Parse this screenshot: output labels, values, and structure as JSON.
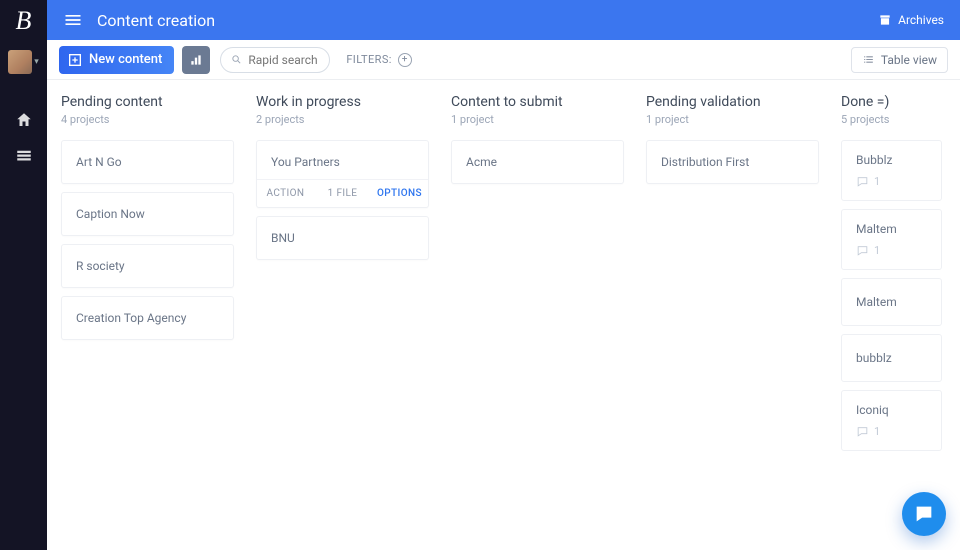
{
  "header": {
    "title": "Content creation",
    "archives": "Archives"
  },
  "toolbar": {
    "new_label": "New content",
    "search_placeholder": "Rapid search",
    "filters_label": "FILTERS:",
    "table_view": "Table view"
  },
  "columns": [
    {
      "title": "Pending content",
      "count_label": "4 projects",
      "cards": [
        {
          "title": "Art N Go"
        },
        {
          "title": "Caption Now"
        },
        {
          "title": "R society"
        },
        {
          "title": "Creation Top Agency"
        }
      ]
    },
    {
      "title": "Work in progress",
      "count_label": "2 projects",
      "cards": [
        {
          "title": "You Partners",
          "footer": {
            "action": "ACTION",
            "file": "1 FILE",
            "options": "OPTIONS"
          }
        },
        {
          "title": "BNU"
        }
      ]
    },
    {
      "title": "Content to submit",
      "count_label": "1 project",
      "cards": [
        {
          "title": "Acme"
        }
      ]
    },
    {
      "title": "Pending validation",
      "count_label": "1 project",
      "cards": [
        {
          "title": "Distribution First"
        }
      ]
    },
    {
      "title": "Done =)",
      "count_label": "5 projects",
      "cards": [
        {
          "title": "Bubblz",
          "comments": "1"
        },
        {
          "title": "Maltem",
          "comments": "1"
        },
        {
          "title": "Maltem"
        },
        {
          "title": "bubblz"
        },
        {
          "title": "Iconiq",
          "comments": "1"
        }
      ]
    }
  ]
}
